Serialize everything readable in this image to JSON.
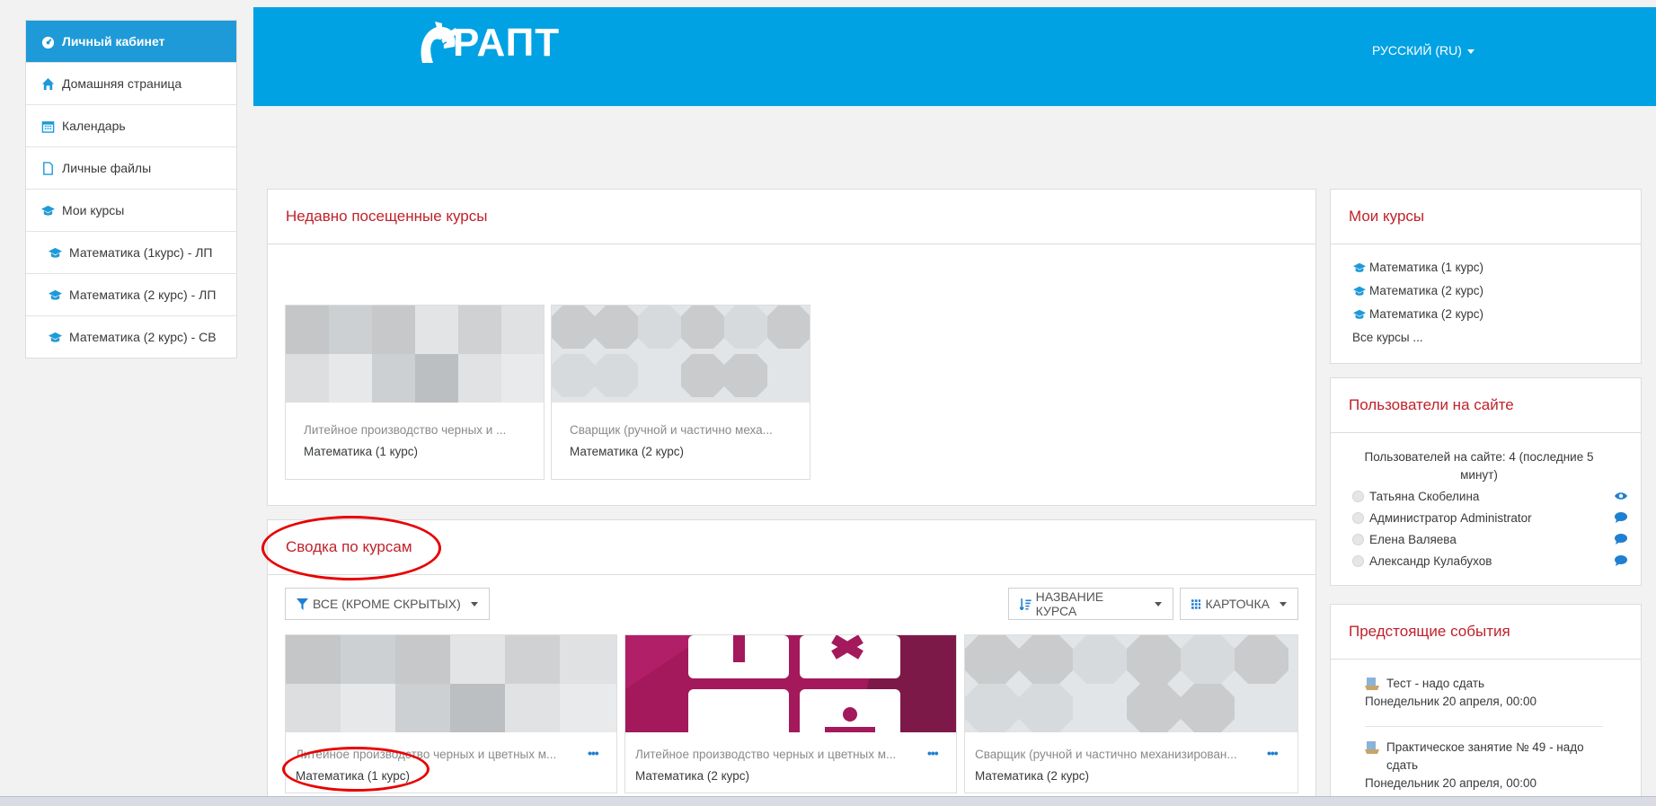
{
  "sidebar": {
    "items": [
      {
        "label": "Личный кабинет",
        "icon": "dashboard-icon"
      },
      {
        "label": "Домашняя страница",
        "icon": "home-icon"
      },
      {
        "label": "Календарь",
        "icon": "calendar-icon"
      },
      {
        "label": "Личные файлы",
        "icon": "file-icon"
      },
      {
        "label": "Мои курсы",
        "icon": "graduation-cap-icon"
      },
      {
        "label": "Математика (1курс) - ЛП",
        "icon": "graduation-cap-icon"
      },
      {
        "label": "Математика (2 курс) - ЛП",
        "icon": "graduation-cap-icon"
      },
      {
        "label": "Математика (2 курс) - СВ",
        "icon": "graduation-cap-icon"
      }
    ]
  },
  "header": {
    "logo_text": "РАПТ",
    "language": "РУССКИЙ (RU)",
    "bg_color": "#00a2e3"
  },
  "recent": {
    "title": "Недавно посещенные курсы",
    "cards": [
      {
        "category": "Литейное производство черных и ...",
        "name": "Математика (1 курс)"
      },
      {
        "category": "Сварщик (ручной и частично меха...",
        "name": "Математика (2 курс)"
      }
    ]
  },
  "overview": {
    "title": "Сводка по курсам",
    "filter_label": "ВСЕ (КРОМЕ СКРЫТЫХ)",
    "sort_label": "НАЗВАНИЕ КУРСА",
    "view_label": "КАРТОЧКА",
    "cards": [
      {
        "category": "Литейное производство черных и цветных м...",
        "name": "Математика (1 курс)",
        "dots": "•••"
      },
      {
        "category": "Литейное производство черных и цветных м...",
        "name": "Математика (2 курс)",
        "dots": "•••"
      },
      {
        "category": "Сварщик (ручной и частично механизирован...",
        "name": "Математика (2 курс)",
        "dots": "•••"
      }
    ]
  },
  "my_courses": {
    "title": "Мои курсы",
    "items": [
      "Математика (1 курс)",
      "Математика (2 курс)",
      "Математика (2 курс)"
    ],
    "all_link": "Все курсы ..."
  },
  "online_users": {
    "title": "Пользователи на сайте",
    "summary": "Пользователей на сайте: 4 (последние 5 минут)",
    "users": [
      {
        "name": "Татьяна Скобелина",
        "action": "eye-icon"
      },
      {
        "name": "Администратор Administrator",
        "action": "message-icon"
      },
      {
        "name": "Елена Валяева",
        "action": "message-icon"
      },
      {
        "name": "Александр Кулабухов",
        "action": "message-icon"
      }
    ]
  },
  "events": {
    "title": "Предстоящие события",
    "items": [
      {
        "title": "Тест - надо сдать",
        "date": "Понедельник 20 апреля, 00:00"
      },
      {
        "title": "Практическое занятие № 49 - надо сдать",
        "date": "Понедельник 20 апреля, 00:00"
      }
    ]
  },
  "colors": {
    "accent": "#1f9ad8",
    "heading": "#c0222b",
    "annotation": "#e80000",
    "link": "#1f7fd1"
  }
}
